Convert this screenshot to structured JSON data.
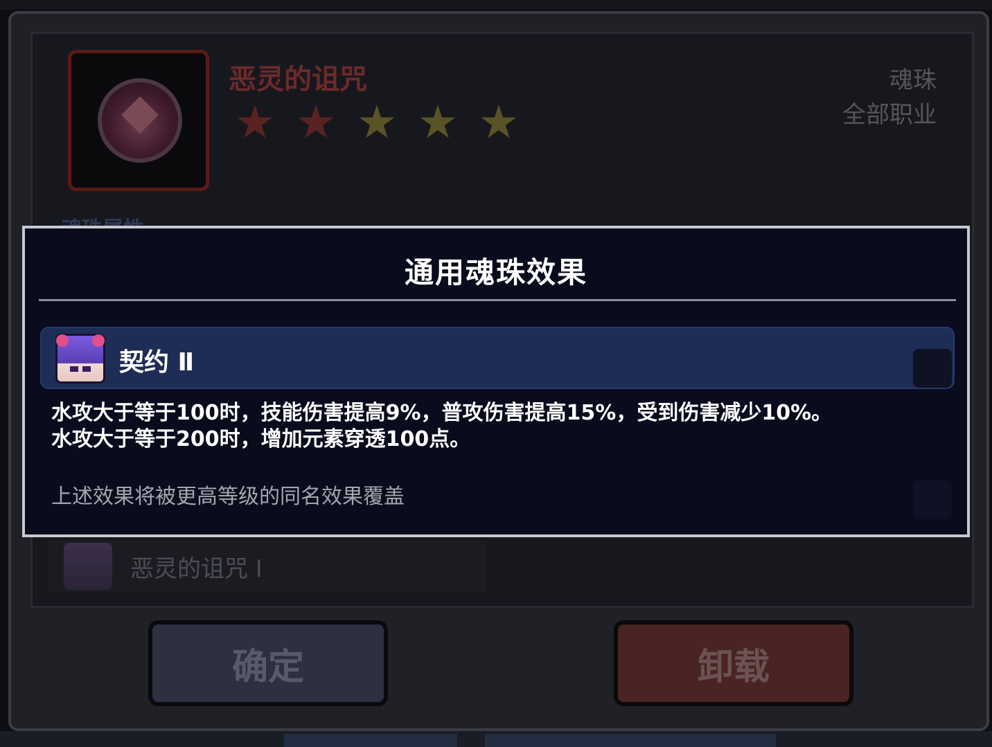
{
  "item": {
    "name": "恶灵的诅咒",
    "stars": [
      {
        "color": "red"
      },
      {
        "color": "red"
      },
      {
        "color": "gold"
      },
      {
        "color": "gold"
      },
      {
        "color": "gold"
      }
    ],
    "type": "魂珠",
    "class": "全部职业",
    "attr_label": "魂珠属性",
    "icon": "cursed-orb-icon"
  },
  "set_entry": {
    "name": "恶灵的诅咒 Ⅰ",
    "icon": "character-avatar-icon"
  },
  "buttons": {
    "confirm": "确定",
    "unequip": "卸载"
  },
  "popup": {
    "title": "通用魂珠效果",
    "effect": {
      "name": "契约 Ⅱ",
      "icon": "character-avatar-icon",
      "lines": [
        "水攻大于等于100时，技能伤害提高9%，普攻伤害提高15%，受到伤害减少10%。",
        "水攻大于等于200时，增加元素穿透100点。"
      ]
    },
    "note": "上述效果将被更高等级的同名效果覆盖"
  },
  "colors": {
    "popup_bg": "#0a0b1d",
    "popup_border": "#c8c8d0",
    "effect_row_bg": "#1e2d55",
    "item_name_dim": "#6b2a2a",
    "unequip_dim": "#4a2323",
    "confirm_dim": "#2e3041"
  }
}
